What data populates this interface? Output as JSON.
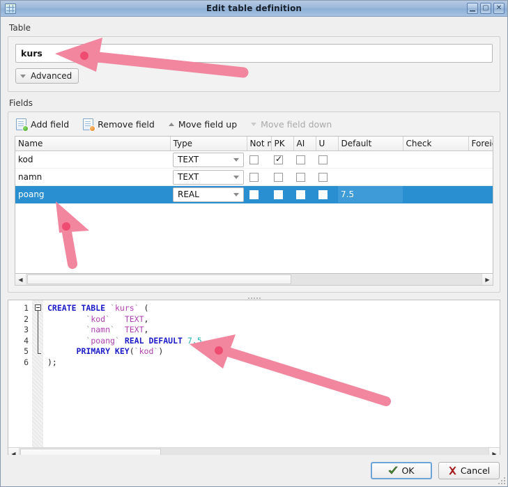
{
  "window": {
    "title": "Edit table definition",
    "icon": "table-icon",
    "buttons": {
      "minimize": "–",
      "maximize": "□",
      "close": "✕"
    }
  },
  "table_section": {
    "label": "Table",
    "name_value": "kurs",
    "name_placeholder": "",
    "advanced_label": "Advanced"
  },
  "fields_section": {
    "label": "Fields",
    "toolbar": [
      {
        "label": "Add field",
        "icon": "document-add-icon",
        "enabled": true
      },
      {
        "label": "Remove field",
        "icon": "document-remove-icon",
        "enabled": true
      },
      {
        "label": "Move field up",
        "icon": "triangle-up-icon",
        "enabled": true
      },
      {
        "label": "Move field down",
        "icon": "triangle-down-icon",
        "enabled": false
      }
    ],
    "columns": [
      "Name",
      "Type",
      "Not n",
      "PK",
      "AI",
      "U",
      "Default",
      "Check",
      "Foreign"
    ],
    "rows": [
      {
        "name": "kod",
        "type": "TEXT",
        "not_null": false,
        "pk": true,
        "ai": false,
        "unique": false,
        "default": "",
        "check": "",
        "foreign": "",
        "selected": false
      },
      {
        "name": "namn",
        "type": "TEXT",
        "not_null": false,
        "pk": false,
        "ai": false,
        "unique": false,
        "default": "",
        "check": "",
        "foreign": "",
        "selected": false
      },
      {
        "name": "poang",
        "type": "REAL",
        "not_null": false,
        "pk": false,
        "ai": false,
        "unique": false,
        "default": "7.5",
        "check": "",
        "foreign": "",
        "selected": true
      }
    ]
  },
  "sql_editor": {
    "line_numbers": [
      "1",
      "2",
      "3",
      "4",
      "5",
      "6"
    ],
    "lines": [
      "CREATE TABLE `kurs` (",
      "      `kod`   TEXT,",
      "      `namn`  TEXT,",
      "      `poang` REAL DEFAULT 7.5,",
      "    PRIMARY KEY(`kod`)",
      ");"
    ],
    "fold_marker": "collapse-box"
  },
  "footer": {
    "ok_label": "OK",
    "cancel_label": "Cancel",
    "ok_icon": "green-check-icon",
    "cancel_icon": "red-x-icon"
  },
  "annotations": {
    "color": "#F2869E",
    "dot_color": "#EF4C72",
    "arrows": [
      {
        "name": "arrow-to-table-name",
        "points_to": "table-name-input"
      },
      {
        "name": "arrow-to-selected-row",
        "points_to": "fields-row-poang"
      },
      {
        "name": "arrow-to-sql",
        "points_to": "sql-editor"
      }
    ]
  }
}
